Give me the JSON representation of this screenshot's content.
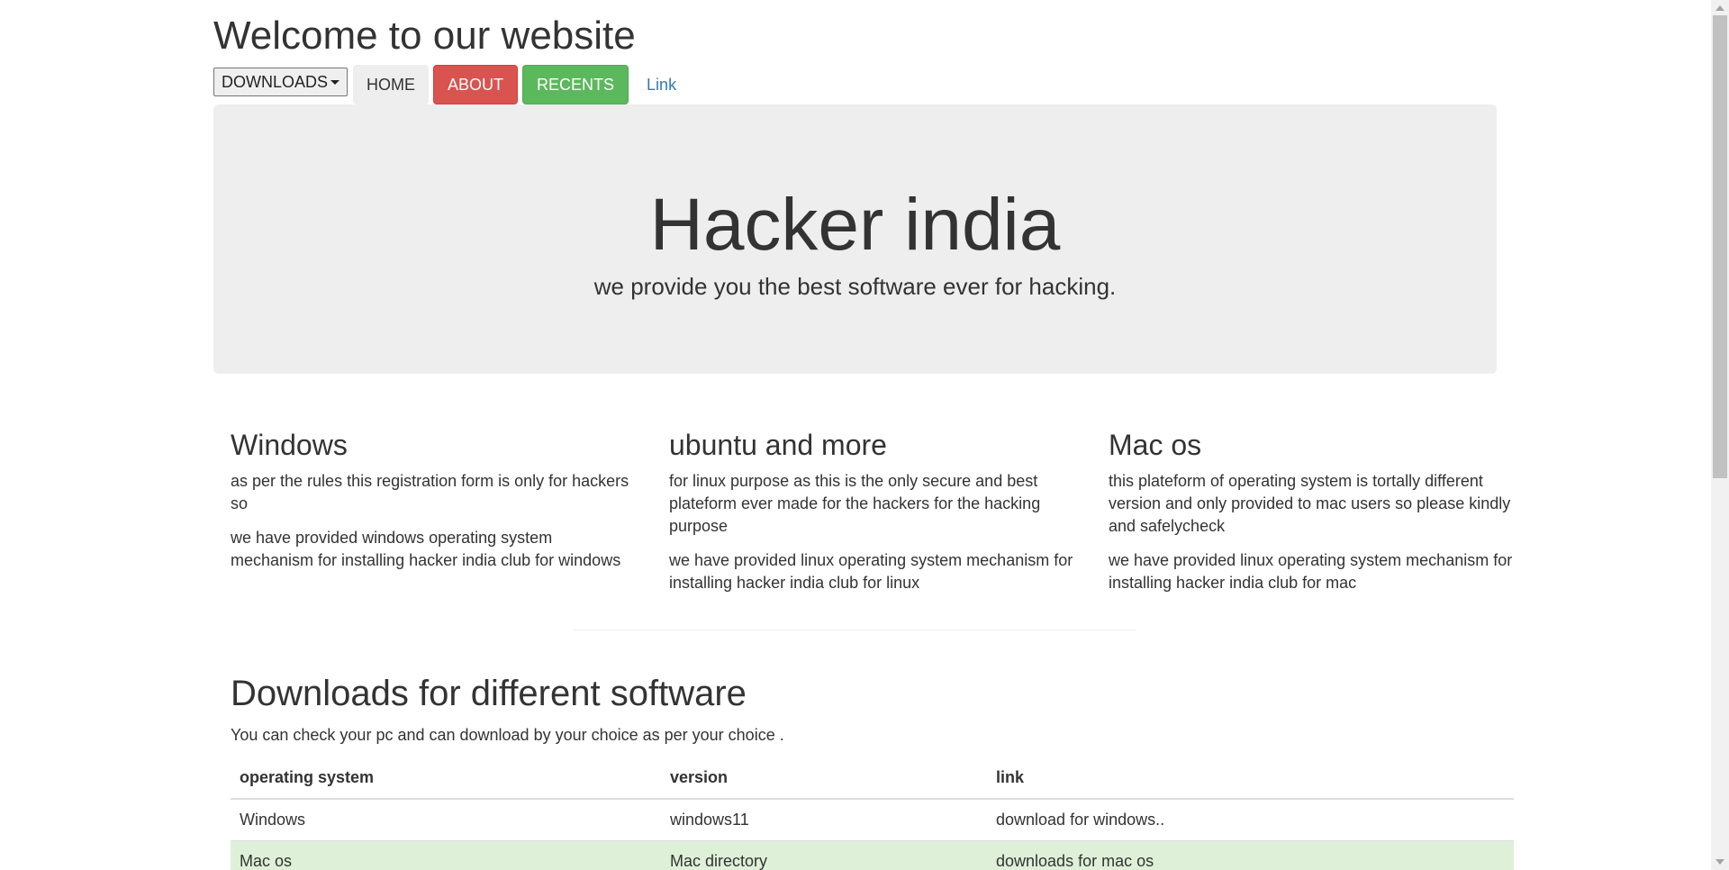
{
  "header": {
    "title": "Welcome to our website"
  },
  "nav": {
    "downloads_label": "DOWNLOADS",
    "home_label": "HOME",
    "about_label": "ABOUT",
    "recents_label": "RECENTS",
    "link_label": "Link"
  },
  "hero": {
    "title": "Hacker india",
    "subtitle": "we provide you the best software ever for hacking."
  },
  "columns": [
    {
      "heading": "Windows",
      "p1": "as per the rules this registration form is only for hackers so",
      "p2": "we have provided windows operating system mechanism for installing hacker india club for windows"
    },
    {
      "heading": "ubuntu and more",
      "p1": "for linux purpose as this is the only secure and best plateform ever made for the hackers for the hacking purpose",
      "p2": "we have provided linux operating system mechanism for installing hacker india club for linux"
    },
    {
      "heading": "Mac os",
      "p1": "this plateform of operating system is tortally different version and only provided to mac users so please kindly and safelycheck",
      "p2": "we have provided linux operating system mechanism for installing hacker india club for mac"
    }
  ],
  "downloads": {
    "title": "Downloads for different software",
    "description": "You can check your pc and can download by your choice as per your choice .",
    "headers": [
      "operating system",
      "version",
      "link"
    ],
    "rows": [
      [
        "Windows",
        "windows11",
        "download for windows.."
      ],
      [
        "Mac os",
        "Mac directory",
        "downloads for mac os"
      ]
    ]
  },
  "colors": {
    "about_bg": "#d9534f",
    "recents_bg": "#5cb85c",
    "link_color": "#337ab7",
    "jumbotron_bg": "#eeeeee",
    "success_row_bg": "#dff0d8"
  },
  "icons": {
    "dropdown": "caret-down-icon"
  }
}
